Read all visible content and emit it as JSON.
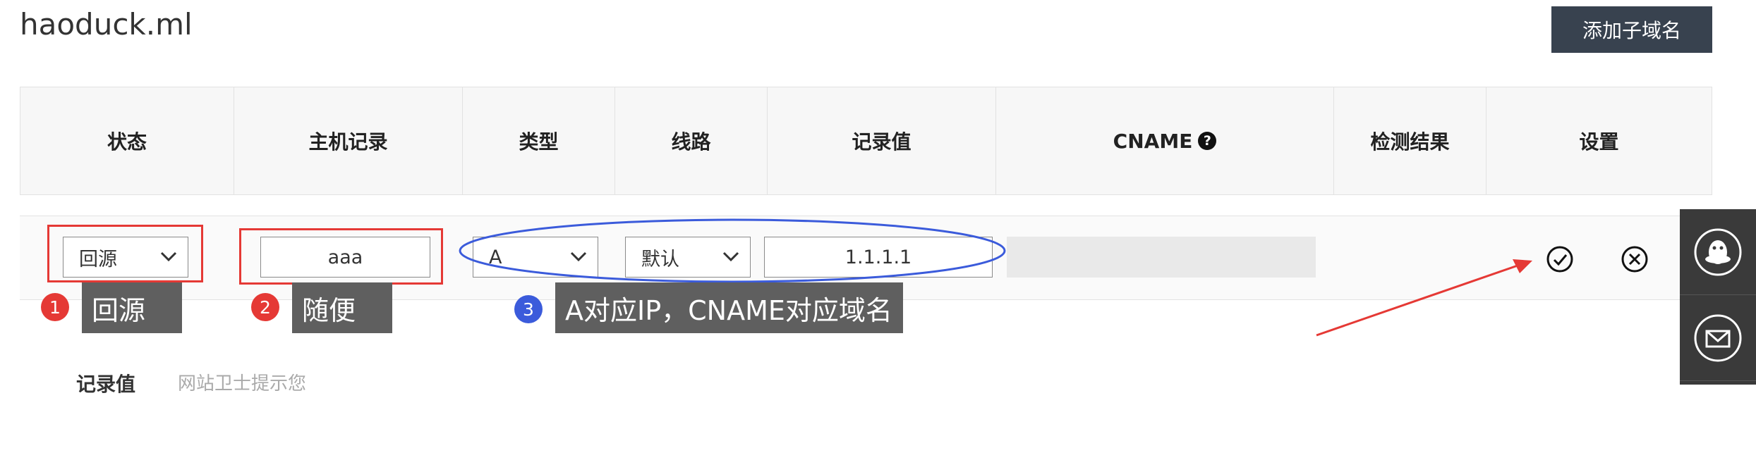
{
  "page": {
    "domain_title": "haoduck.ml",
    "add_subdomain_label": "添加子域名"
  },
  "table": {
    "headers": [
      "状态",
      "主机记录",
      "类型",
      "线路",
      "记录值",
      "CNAME",
      "检测结果",
      "设置"
    ],
    "cname_help_icon": "question-circle-icon",
    "row": {
      "status": "回源",
      "host": "aaa",
      "type": "A",
      "line": "默认",
      "value": "1.1.1.1"
    }
  },
  "annotations": [
    {
      "number": "1",
      "text": "回源",
      "color": "#e53935"
    },
    {
      "number": "2",
      "text": "随便",
      "color": "#e53935"
    },
    {
      "number": "3",
      "text": "A对应IP，CNAME对应域名",
      "color": "#3b5bdb"
    }
  ],
  "actions": {
    "confirm_icon": "check-circle-icon",
    "cancel_icon": "x-circle-icon"
  },
  "sidebar": {
    "items": [
      {
        "icon": "qq-penguin-icon"
      },
      {
        "icon": "mail-icon"
      }
    ]
  },
  "footer": {
    "label": "记录值",
    "hint": "网站卫士提示您"
  },
  "colors": {
    "button_bg": "#38424f",
    "annotation_red": "#e53935",
    "annotation_blue": "#3b5bdb",
    "tip_bg": "#5f5f5f",
    "sidebar_bg": "#3a3a3a"
  }
}
